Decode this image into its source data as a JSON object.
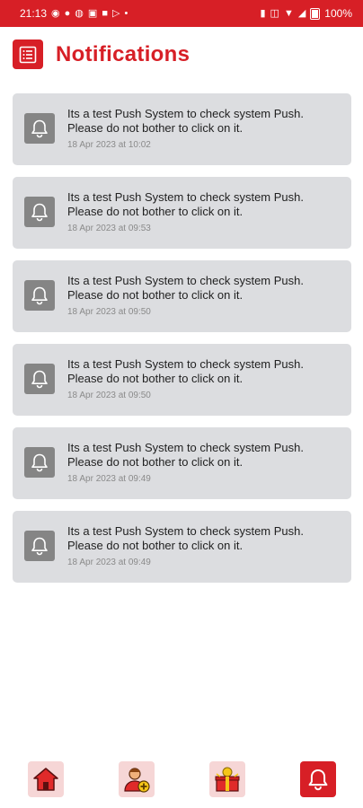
{
  "status_bar": {
    "time": "21:13",
    "battery": "100%"
  },
  "header": {
    "title": "Notifications",
    "menu_icon": "list-menu-icon"
  },
  "notifications": [
    {
      "message": "Its a test Push System to check system Push. Please do not bother to click on it.",
      "time": "18 Apr 2023 at 10:02"
    },
    {
      "message": "Its a test Push System to check system Push. Please do not bother to click on it.",
      "time": "18 Apr 2023 at 09:53"
    },
    {
      "message": "Its a test Push System to check system Push. Please do not bother to click on it.",
      "time": "18 Apr 2023 at 09:50"
    },
    {
      "message": "Its a test Push System to check system Push. Please do not bother to click on it.",
      "time": "18 Apr 2023 at 09:50"
    },
    {
      "message": "Its a test Push System to check system Push. Please do not bother to click on it.",
      "time": "18 Apr 2023 at 09:49"
    },
    {
      "message": "Its a test Push System to check system Push. Please do not bother to click on it.",
      "time": "18 Apr 2023 at 09:49"
    }
  ],
  "bottom_nav": [
    {
      "icon": "home-icon",
      "active": false
    },
    {
      "icon": "add-user-icon",
      "active": false
    },
    {
      "icon": "gift-icon",
      "active": false
    },
    {
      "icon": "bell-icon",
      "active": true
    }
  ],
  "colors": {
    "accent": "#d71f26",
    "card_bg": "#dcdde0",
    "icon_bg": "#858585"
  }
}
